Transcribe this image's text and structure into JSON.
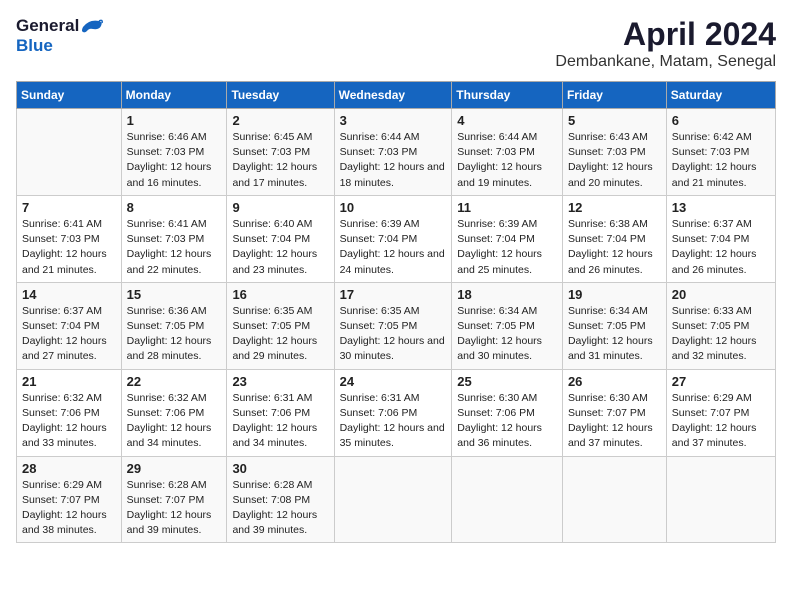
{
  "logo": {
    "general": "General",
    "blue": "Blue"
  },
  "title": "April 2024",
  "subtitle": "Dembankane, Matam, Senegal",
  "days_of_week": [
    "Sunday",
    "Monday",
    "Tuesday",
    "Wednesday",
    "Thursday",
    "Friday",
    "Saturday"
  ],
  "weeks": [
    [
      {
        "day": "",
        "sunrise": "",
        "sunset": "",
        "daylight": ""
      },
      {
        "day": "1",
        "sunrise": "Sunrise: 6:46 AM",
        "sunset": "Sunset: 7:03 PM",
        "daylight": "Daylight: 12 hours and 16 minutes."
      },
      {
        "day": "2",
        "sunrise": "Sunrise: 6:45 AM",
        "sunset": "Sunset: 7:03 PM",
        "daylight": "Daylight: 12 hours and 17 minutes."
      },
      {
        "day": "3",
        "sunrise": "Sunrise: 6:44 AM",
        "sunset": "Sunset: 7:03 PM",
        "daylight": "Daylight: 12 hours and 18 minutes."
      },
      {
        "day": "4",
        "sunrise": "Sunrise: 6:44 AM",
        "sunset": "Sunset: 7:03 PM",
        "daylight": "Daylight: 12 hours and 19 minutes."
      },
      {
        "day": "5",
        "sunrise": "Sunrise: 6:43 AM",
        "sunset": "Sunset: 7:03 PM",
        "daylight": "Daylight: 12 hours and 20 minutes."
      },
      {
        "day": "6",
        "sunrise": "Sunrise: 6:42 AM",
        "sunset": "Sunset: 7:03 PM",
        "daylight": "Daylight: 12 hours and 21 minutes."
      }
    ],
    [
      {
        "day": "7",
        "sunrise": "Sunrise: 6:41 AM",
        "sunset": "Sunset: 7:03 PM",
        "daylight": "Daylight: 12 hours and 21 minutes."
      },
      {
        "day": "8",
        "sunrise": "Sunrise: 6:41 AM",
        "sunset": "Sunset: 7:03 PM",
        "daylight": "Daylight: 12 hours and 22 minutes."
      },
      {
        "day": "9",
        "sunrise": "Sunrise: 6:40 AM",
        "sunset": "Sunset: 7:04 PM",
        "daylight": "Daylight: 12 hours and 23 minutes."
      },
      {
        "day": "10",
        "sunrise": "Sunrise: 6:39 AM",
        "sunset": "Sunset: 7:04 PM",
        "daylight": "Daylight: 12 hours and 24 minutes."
      },
      {
        "day": "11",
        "sunrise": "Sunrise: 6:39 AM",
        "sunset": "Sunset: 7:04 PM",
        "daylight": "Daylight: 12 hours and 25 minutes."
      },
      {
        "day": "12",
        "sunrise": "Sunrise: 6:38 AM",
        "sunset": "Sunset: 7:04 PM",
        "daylight": "Daylight: 12 hours and 26 minutes."
      },
      {
        "day": "13",
        "sunrise": "Sunrise: 6:37 AM",
        "sunset": "Sunset: 7:04 PM",
        "daylight": "Daylight: 12 hours and 26 minutes."
      }
    ],
    [
      {
        "day": "14",
        "sunrise": "Sunrise: 6:37 AM",
        "sunset": "Sunset: 7:04 PM",
        "daylight": "Daylight: 12 hours and 27 minutes."
      },
      {
        "day": "15",
        "sunrise": "Sunrise: 6:36 AM",
        "sunset": "Sunset: 7:05 PM",
        "daylight": "Daylight: 12 hours and 28 minutes."
      },
      {
        "day": "16",
        "sunrise": "Sunrise: 6:35 AM",
        "sunset": "Sunset: 7:05 PM",
        "daylight": "Daylight: 12 hours and 29 minutes."
      },
      {
        "day": "17",
        "sunrise": "Sunrise: 6:35 AM",
        "sunset": "Sunset: 7:05 PM",
        "daylight": "Daylight: 12 hours and 30 minutes."
      },
      {
        "day": "18",
        "sunrise": "Sunrise: 6:34 AM",
        "sunset": "Sunset: 7:05 PM",
        "daylight": "Daylight: 12 hours and 30 minutes."
      },
      {
        "day": "19",
        "sunrise": "Sunrise: 6:34 AM",
        "sunset": "Sunset: 7:05 PM",
        "daylight": "Daylight: 12 hours and 31 minutes."
      },
      {
        "day": "20",
        "sunrise": "Sunrise: 6:33 AM",
        "sunset": "Sunset: 7:05 PM",
        "daylight": "Daylight: 12 hours and 32 minutes."
      }
    ],
    [
      {
        "day": "21",
        "sunrise": "Sunrise: 6:32 AM",
        "sunset": "Sunset: 7:06 PM",
        "daylight": "Daylight: 12 hours and 33 minutes."
      },
      {
        "day": "22",
        "sunrise": "Sunrise: 6:32 AM",
        "sunset": "Sunset: 7:06 PM",
        "daylight": "Daylight: 12 hours and 34 minutes."
      },
      {
        "day": "23",
        "sunrise": "Sunrise: 6:31 AM",
        "sunset": "Sunset: 7:06 PM",
        "daylight": "Daylight: 12 hours and 34 minutes."
      },
      {
        "day": "24",
        "sunrise": "Sunrise: 6:31 AM",
        "sunset": "Sunset: 7:06 PM",
        "daylight": "Daylight: 12 hours and 35 minutes."
      },
      {
        "day": "25",
        "sunrise": "Sunrise: 6:30 AM",
        "sunset": "Sunset: 7:06 PM",
        "daylight": "Daylight: 12 hours and 36 minutes."
      },
      {
        "day": "26",
        "sunrise": "Sunrise: 6:30 AM",
        "sunset": "Sunset: 7:07 PM",
        "daylight": "Daylight: 12 hours and 37 minutes."
      },
      {
        "day": "27",
        "sunrise": "Sunrise: 6:29 AM",
        "sunset": "Sunset: 7:07 PM",
        "daylight": "Daylight: 12 hours and 37 minutes."
      }
    ],
    [
      {
        "day": "28",
        "sunrise": "Sunrise: 6:29 AM",
        "sunset": "Sunset: 7:07 PM",
        "daylight": "Daylight: 12 hours and 38 minutes."
      },
      {
        "day": "29",
        "sunrise": "Sunrise: 6:28 AM",
        "sunset": "Sunset: 7:07 PM",
        "daylight": "Daylight: 12 hours and 39 minutes."
      },
      {
        "day": "30",
        "sunrise": "Sunrise: 6:28 AM",
        "sunset": "Sunset: 7:08 PM",
        "daylight": "Daylight: 12 hours and 39 minutes."
      },
      {
        "day": "",
        "sunrise": "",
        "sunset": "",
        "daylight": ""
      },
      {
        "day": "",
        "sunrise": "",
        "sunset": "",
        "daylight": ""
      },
      {
        "day": "",
        "sunrise": "",
        "sunset": "",
        "daylight": ""
      },
      {
        "day": "",
        "sunrise": "",
        "sunset": "",
        "daylight": ""
      }
    ]
  ]
}
